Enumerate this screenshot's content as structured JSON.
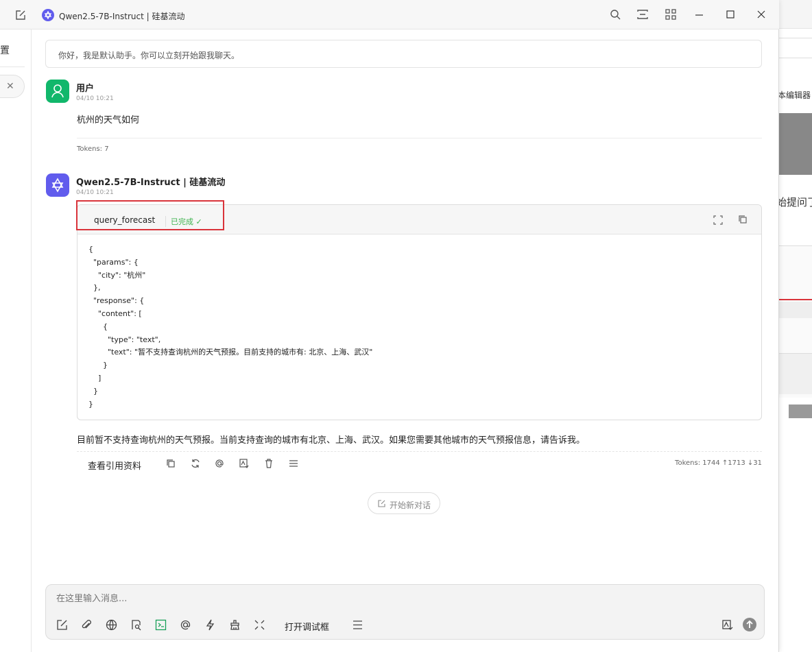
{
  "window": {
    "title": "Qwen2.5-7B-Instruct | 硅基流动"
  },
  "sidebar": {
    "partial_label": "置"
  },
  "system_message": "你好，我是默认助手。你可以立刻开始跟我聊天。",
  "messages": [
    {
      "role": "user",
      "name": "用户",
      "time": "04/10 10:21",
      "text": "杭州的天气如何",
      "tokens": "Tokens: 7"
    },
    {
      "role": "assistant",
      "name": "Qwen2.5-7B-Instruct | 硅基流动",
      "time": "04/10 10:21",
      "tool": {
        "name": "query_forecast",
        "status": "已完成 ✓",
        "code": "{\n  \"params\": {\n    \"city\": \"杭州\"\n  },\n  \"response\": {\n    \"content\": [\n      {\n        \"type\": \"text\",\n        \"text\": \"暂不支持查询杭州的天气预报。目前支持的城市有: 北京、上海、武汉\"\n      }\n    ]\n  }\n}"
      },
      "text": "目前暂不支持查询杭州的天气预报。当前支持查询的城市有北京、上海、武汉。如果您需要其他城市的天气预报信息，请告诉我。",
      "actions_label": "查看引用资料",
      "tokens": "Tokens: 1744 ↑1713 ↓31"
    }
  ],
  "new_chat_label": "开始新对话",
  "composer": {
    "placeholder": "在这里输入消息...",
    "debug_label": "打开调试框"
  },
  "background_window": {
    "text1": "本编辑器",
    "text2": "始提问了"
  }
}
